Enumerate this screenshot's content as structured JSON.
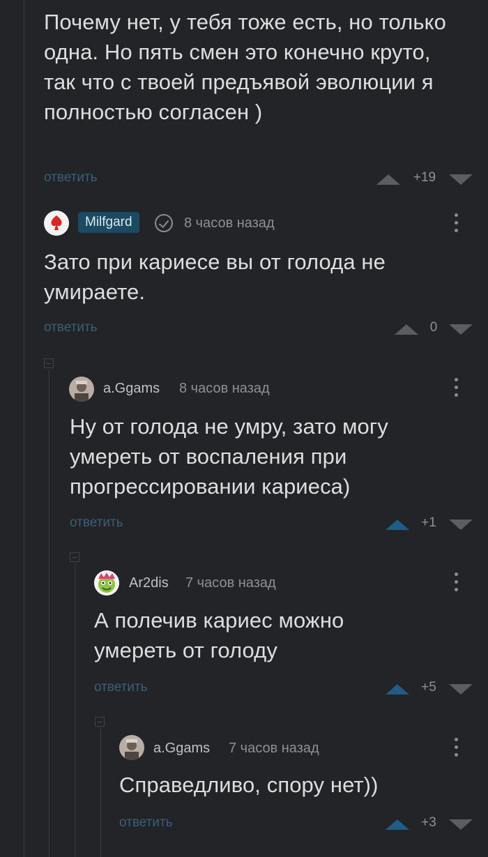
{
  "comments": [
    {
      "text": "Почему нет, у тебя тоже есть, но только одна. Но пять смен это конечно круто, так что с твоей предъявой эволюции я полностью согласен )",
      "reply_label": "ответить",
      "score": "+19"
    },
    {
      "author": "Milfgard",
      "time": "8 часов назад",
      "text": "Зато при кариесе вы от голода не умираете.",
      "reply_label": "ответить",
      "score": "0"
    },
    {
      "author": "a.Ggams",
      "time": "8 часов назад",
      "text": "Ну от голода не умру, зато могу умереть от воспаления при прогрессировании кариеса)",
      "reply_label": "ответить",
      "score": "+1"
    },
    {
      "author": "Ar2dis",
      "time": "7 часов назад",
      "text": "А полечив кариес можно умереть от голоду",
      "reply_label": "ответить",
      "score": "+5"
    },
    {
      "author": "a.Ggams",
      "time": "7 часов назад",
      "text": "Справедливо, спору нет))",
      "reply_label": "ответить",
      "score": "+3"
    }
  ],
  "colors": {
    "background": "#222427",
    "reply_link": "#3d5e78",
    "upvote_active": "#1f5c87",
    "author_badge": "#1c4a63"
  },
  "icons": [
    "milfgard-avatar-icon",
    "verified-check-icon",
    "user-avatar-icon",
    "menu-dots-icon",
    "upvote-icon",
    "downvote-icon",
    "collapse-icon"
  ]
}
